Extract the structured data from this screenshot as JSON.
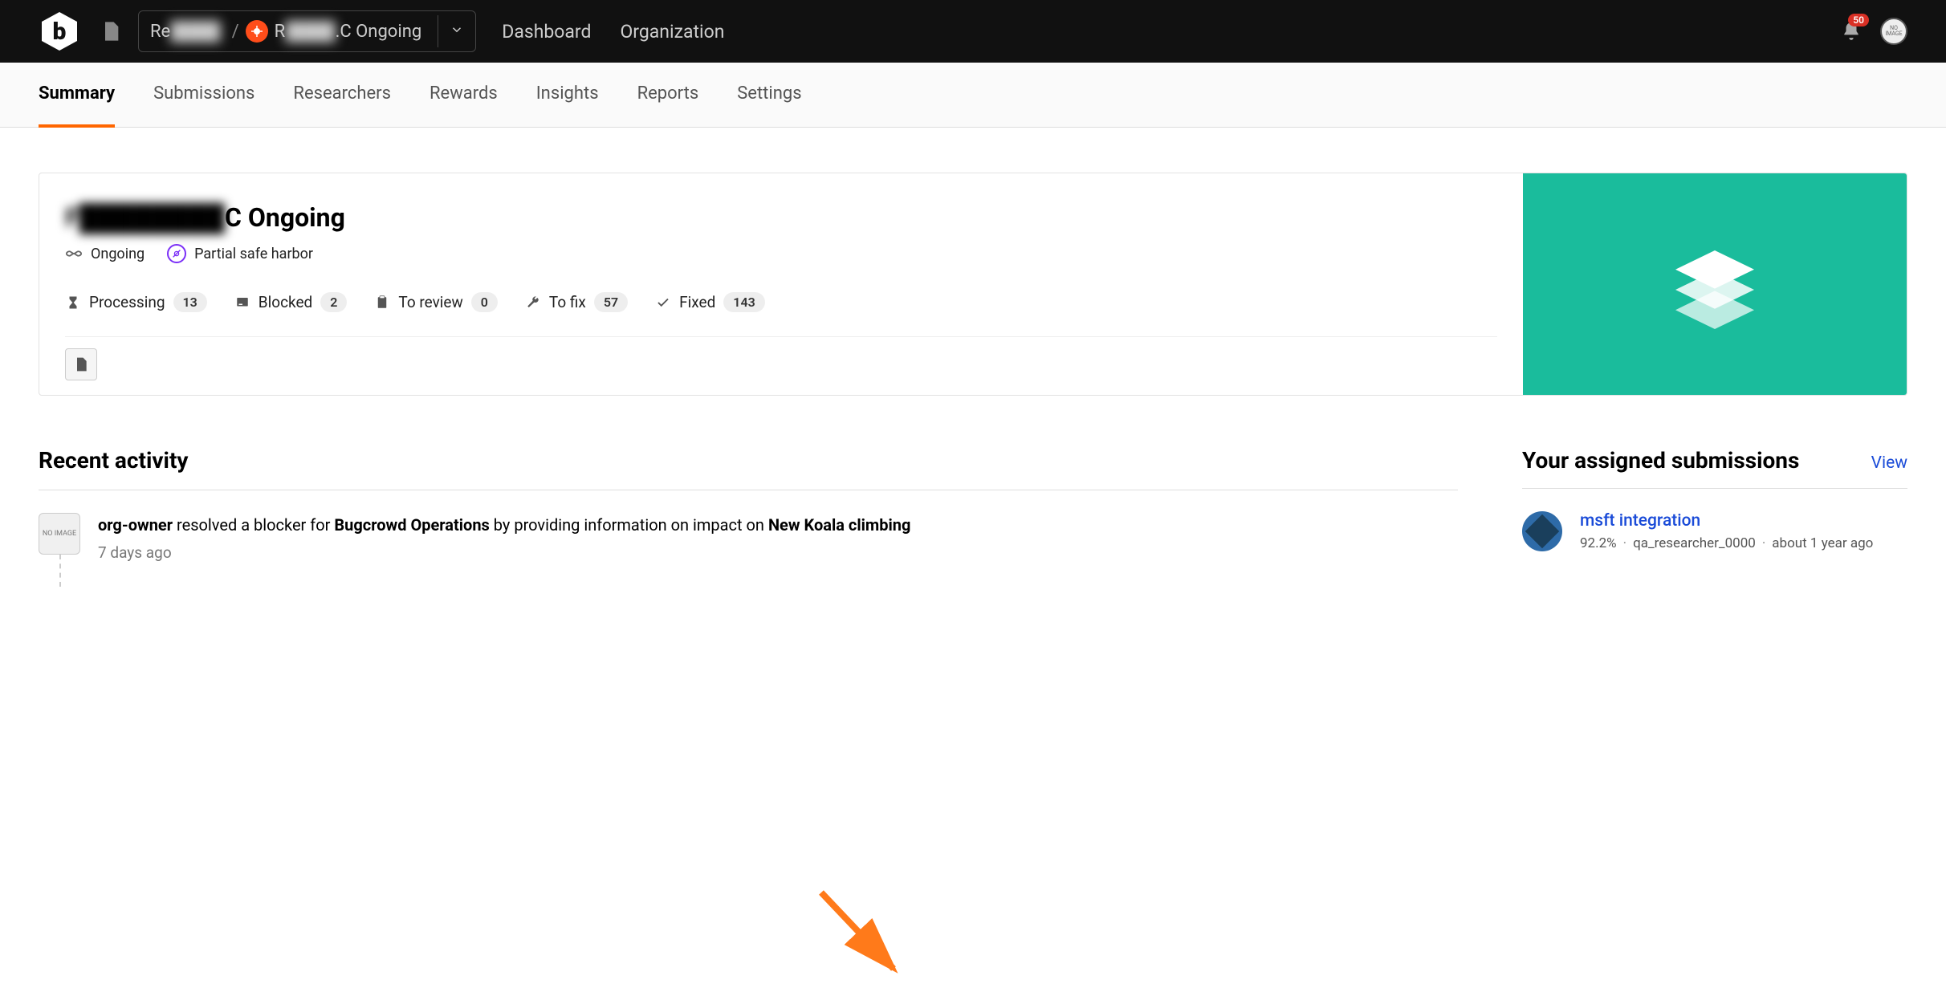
{
  "topbar": {
    "breadcrumb": {
      "org_prefix": "Re",
      "org_blurred": "████",
      "separator": "/",
      "program_prefix": "R",
      "program_blurred": "████",
      "program_suffix": ".C Ongoing"
    },
    "nav": {
      "dashboard": "Dashboard",
      "organization": "Organization"
    },
    "notifications_count": "50"
  },
  "tabs": {
    "summary": "Summary",
    "submissions": "Submissions",
    "researchers": "Researchers",
    "rewards": "Rewards",
    "insights": "Insights",
    "reports": "Reports",
    "settings": "Settings"
  },
  "hero": {
    "title_blurred": "F████████",
    "title_suffix": "C Ongoing",
    "status": "Ongoing",
    "safe_harbor": "Partial safe harbor",
    "stats": {
      "processing_label": "Processing",
      "processing_count": "13",
      "blocked_label": "Blocked",
      "blocked_count": "2",
      "to_review_label": "To review",
      "to_review_count": "0",
      "to_fix_label": "To fix",
      "to_fix_count": "57",
      "fixed_label": "Fixed",
      "fixed_count": "143"
    }
  },
  "recent_activity": {
    "heading": "Recent activity",
    "item": {
      "actor": "org-owner",
      "action_1": " resolved a blocker for ",
      "target_1": "Bugcrowd Operations",
      "action_2": " by providing information on impact on ",
      "target_2": "New Koala climbing",
      "time": "7 days ago"
    }
  },
  "assigned": {
    "heading": "Your assigned submissions",
    "view_link": "View",
    "item": {
      "title": "msft integration",
      "percent": "92.2%",
      "researcher": "qa_researcher_0000",
      "time": "about 1 year ago"
    }
  },
  "no_image_label": "NO IMAGE"
}
